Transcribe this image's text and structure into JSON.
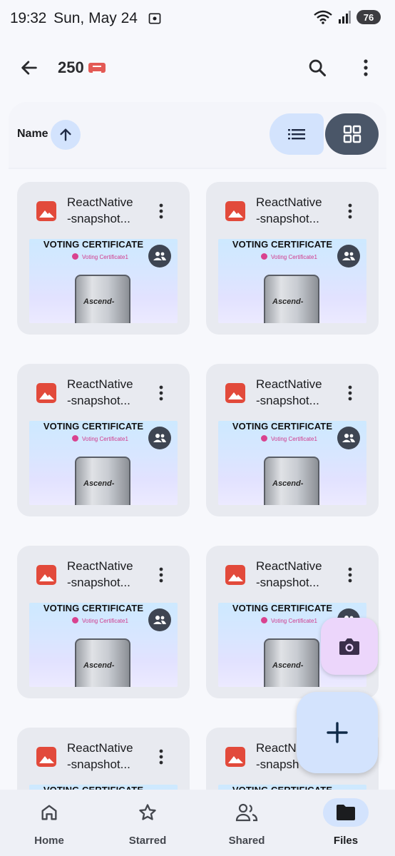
{
  "status_bar": {
    "time": "19:32",
    "date": "Sun, May 24",
    "battery": "76",
    "icons": [
      "screen-cast-icon",
      "wifi-icon",
      "signal-icon",
      "battery-icon"
    ]
  },
  "app_bar": {
    "title": "250",
    "icons": [
      "back-arrow-icon",
      "label-badge-icon",
      "search-icon",
      "more-vertical-icon"
    ]
  },
  "sort": {
    "label": "Name",
    "direction": "ascending"
  },
  "files": [
    {
      "name_line1": "ReactNative",
      "name_line2": "-snapshot...",
      "thumb_title": "VOTING CERTIFICATE",
      "thumb_sub": "Voting Certificate1",
      "thumb_device": "Ascend-"
    },
    {
      "name_line1": "ReactNative",
      "name_line2": "-snapshot...",
      "thumb_title": "VOTING CERTIFICATE",
      "thumb_sub": "Voting Certificate1",
      "thumb_device": "Ascend-"
    },
    {
      "name_line1": "ReactNative",
      "name_line2": "-snapshot...",
      "thumb_title": "VOTING CERTIFICATE",
      "thumb_sub": "Voting Certificate1",
      "thumb_device": "Ascend-"
    },
    {
      "name_line1": "ReactNative",
      "name_line2": "-snapshot...",
      "thumb_title": "VOTING CERTIFICATE",
      "thumb_sub": "Voting Certificate1",
      "thumb_device": "Ascend-"
    },
    {
      "name_line1": "ReactNative",
      "name_line2": "-snapshot...",
      "thumb_title": "VOTING CERTIFICATE",
      "thumb_sub": "Voting Certificate1",
      "thumb_device": "Ascend-"
    },
    {
      "name_line1": "ReactNative",
      "name_line2": "-snapshot...",
      "thumb_title": "VOTING CERTIFICATE",
      "thumb_sub": "Voting Certificate1",
      "thumb_device": "Ascend-"
    },
    {
      "name_line1": "ReactNative",
      "name_line2": "-snapshot...",
      "thumb_title": "VOTING CERTIFICATE",
      "thumb_sub": "",
      "thumb_device": ""
    },
    {
      "name_line1": "ReactN",
      "name_line2": "-snapsh",
      "thumb_title": "VOTING CERTIFICATE",
      "thumb_sub": "",
      "thumb_device": ""
    }
  ],
  "bottom_nav": [
    {
      "label": "Home",
      "icon": "home-icon",
      "active": false
    },
    {
      "label": "Starred",
      "icon": "star-icon",
      "active": false
    },
    {
      "label": "Shared",
      "icon": "people-icon",
      "active": false
    },
    {
      "label": "Files",
      "icon": "folder-icon",
      "active": true
    }
  ],
  "colors": {
    "accent_container": "#d3e3fd",
    "camera_fab": "#ecd6fb",
    "image_icon": "#e24a3b",
    "grid_toggle_active": "#4a5668"
  }
}
